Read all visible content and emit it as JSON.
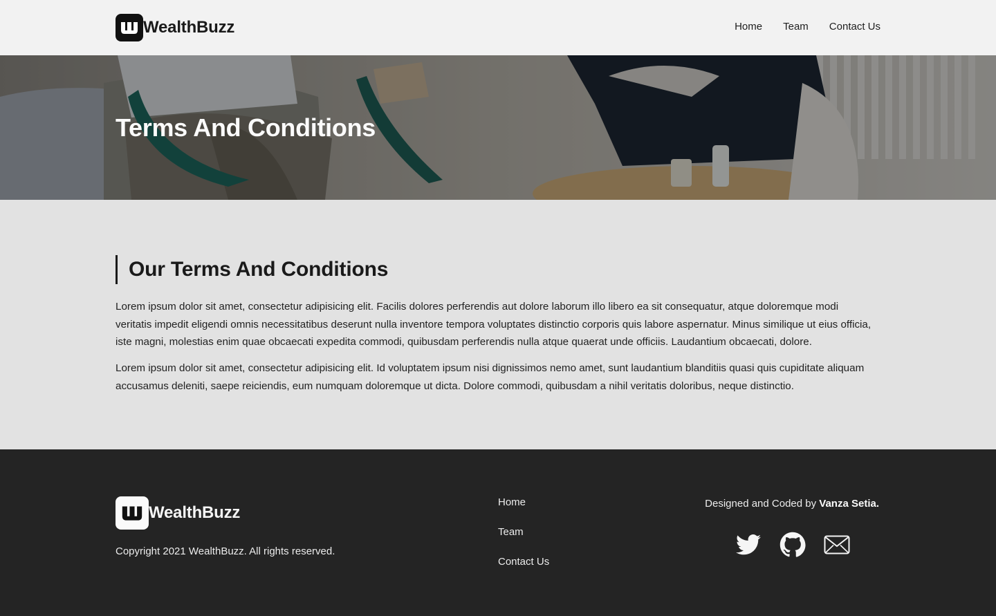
{
  "header": {
    "brand": "WealthBuzz",
    "nav": [
      "Home",
      "Team",
      "Contact Us"
    ]
  },
  "hero": {
    "title": "Terms And Conditions"
  },
  "main": {
    "heading": "Our Terms And Conditions",
    "paragraphs": [
      "Lorem ipsum dolor sit amet, consectetur adipisicing elit. Facilis dolores perferendis aut dolore laborum illo libero ea sit consequatur, atque doloremque modi veritatis impedit eligendi omnis necessitatibus deserunt nulla inventore tempora voluptates distinctio corporis quis labore aspernatur. Minus similique ut eius officia, iste magni, molestias enim quae obcaecati expedita commodi, quibusdam perferendis nulla atque quaerat unde officiis. Laudantium obcaecati, dolore.",
      "Lorem ipsum dolor sit amet, consectetur adipisicing elit. Id voluptatem ipsum nisi dignissimos nemo amet, sunt laudantium blanditiis quasi quis cupiditate aliquam accusamus deleniti, saepe reiciendis, eum numquam doloremque ut dicta. Dolore commodi, quibusdam a nihil veritatis doloribus, neque distinctio."
    ]
  },
  "footer": {
    "brand": "WealthBuzz",
    "copyright": "Copyright 2021 WealthBuzz. All rights reserved.",
    "links": [
      "Home",
      "Team",
      "Contact Us"
    ],
    "credit_prefix": "Designed and Coded by",
    "credit_name": "Vanza Setia.",
    "socials": [
      "twitter-icon",
      "github-icon",
      "mail-icon"
    ]
  },
  "colors": {
    "header_bg": "#f2f2f2",
    "main_bg": "#e2e2e2",
    "footer_bg": "#242424",
    "text_dark": "#1a1a1a"
  }
}
